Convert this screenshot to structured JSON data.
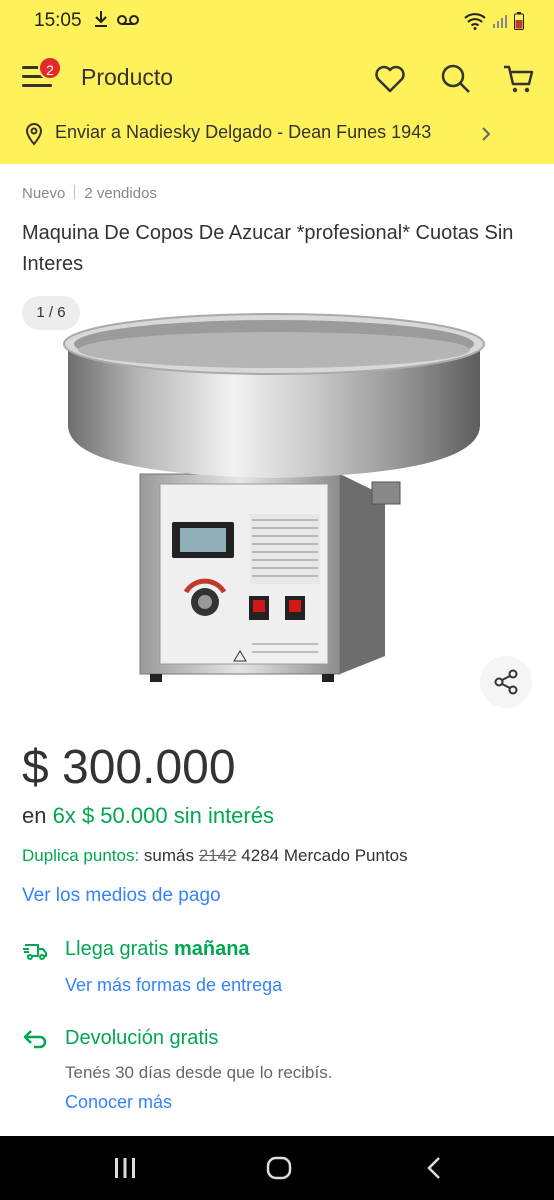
{
  "status": {
    "time": "15:05",
    "left_icons": [
      "download-icon",
      "voicemail-icon"
    ],
    "right_icons": [
      "wifi-icon",
      "signal-icon",
      "battery-icon"
    ]
  },
  "header": {
    "title": "Producto",
    "badge_count": "2",
    "icons": [
      "menu-icon",
      "heart-icon",
      "search-icon",
      "cart-icon"
    ]
  },
  "shipping": {
    "text": "Enviar a Nadiesky Delgado - Dean Funes 1943"
  },
  "product": {
    "condition": "Nuevo",
    "sold": "2 vendidos",
    "title": "Maquina De Copos De Azucar *profesional* Cuotas Sin Interes",
    "image_counter": "1 / 6",
    "price": "$ 300.000",
    "installments_prefix": "en",
    "installments_value": "6x $ 50.000 sin interés",
    "points_label": "Duplica puntos:",
    "points_text_1": "sumás",
    "points_old": "2142",
    "points_new": "4284 Mercado Puntos",
    "payment_link": "Ver los medios de pago"
  },
  "delivery": {
    "free_label": "Llega gratis",
    "free_day": "mañana",
    "more_link": "Ver más formas de entrega"
  },
  "returns": {
    "title": "Devolución gratis",
    "description": "Tenés 30 días desde que lo recibís.",
    "link": "Conocer más"
  },
  "colors": {
    "brand_yellow": "#fff159",
    "green": "#00a650",
    "link_blue": "#3483fa",
    "badge_red": "#e3292e"
  }
}
